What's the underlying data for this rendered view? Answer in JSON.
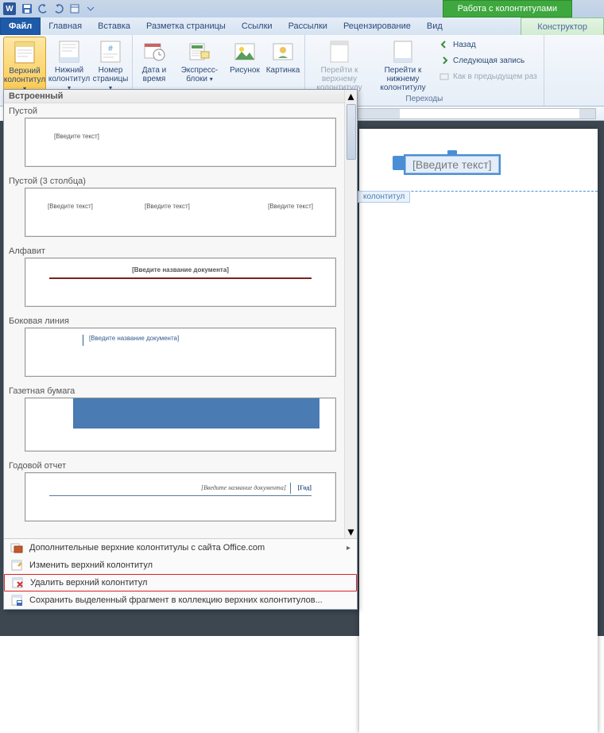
{
  "titlebar": {
    "contextual_tab": "Работа с колонтитулами"
  },
  "tabs": {
    "file": "Файл",
    "home": "Главная",
    "insert": "Вставка",
    "layout": "Разметка страницы",
    "references": "Ссылки",
    "mailings": "Рассылки",
    "review": "Рецензирование",
    "view": "Вид",
    "design": "Конструктор"
  },
  "ribbon": {
    "header": {
      "label": "Верхний колонтитул"
    },
    "footer": {
      "label": "Нижний колонтитул"
    },
    "pagenum": {
      "label": "Номер страницы"
    },
    "datetime": {
      "label": "Дата и время"
    },
    "quickparts": {
      "label": "Экспресс-блоки"
    },
    "picture": {
      "label": "Рисунок"
    },
    "clipart": {
      "label": "Картинка"
    },
    "goto_header": {
      "label": "Перейти к верхнему колонтитулу"
    },
    "goto_footer": {
      "label": "Перейти к нижнему колонтитулу"
    },
    "group_nav": "Переходы",
    "back": "Назад",
    "next": "Следующая запись",
    "link_prev": "Как в предыдущем раз"
  },
  "gallery": {
    "section_builtin": "Встроенный",
    "items": {
      "blank": "Пустой",
      "blank3": "Пустой (3 столбца)",
      "alphabet": "Алфавит",
      "sideline": "Боковая линия",
      "newspaper": "Газетная бумага",
      "annual": "Годовой отчет"
    },
    "ph_text": "[Введите текст]",
    "ph_doc_title": "[Введите название документа]",
    "ph_year": "[Год]",
    "menu": {
      "more": "Дополнительные верхние колонтитулы с сайта Office.com",
      "edit": "Изменить верхний колонтитул",
      "remove": "Удалить верхний колонтитул",
      "save": "Сохранить выделенный фрагмент в коллекцию верхних колонтитулов..."
    }
  },
  "document": {
    "header_tag": "колонтитул",
    "content_placeholder": "[Введите текст]"
  }
}
